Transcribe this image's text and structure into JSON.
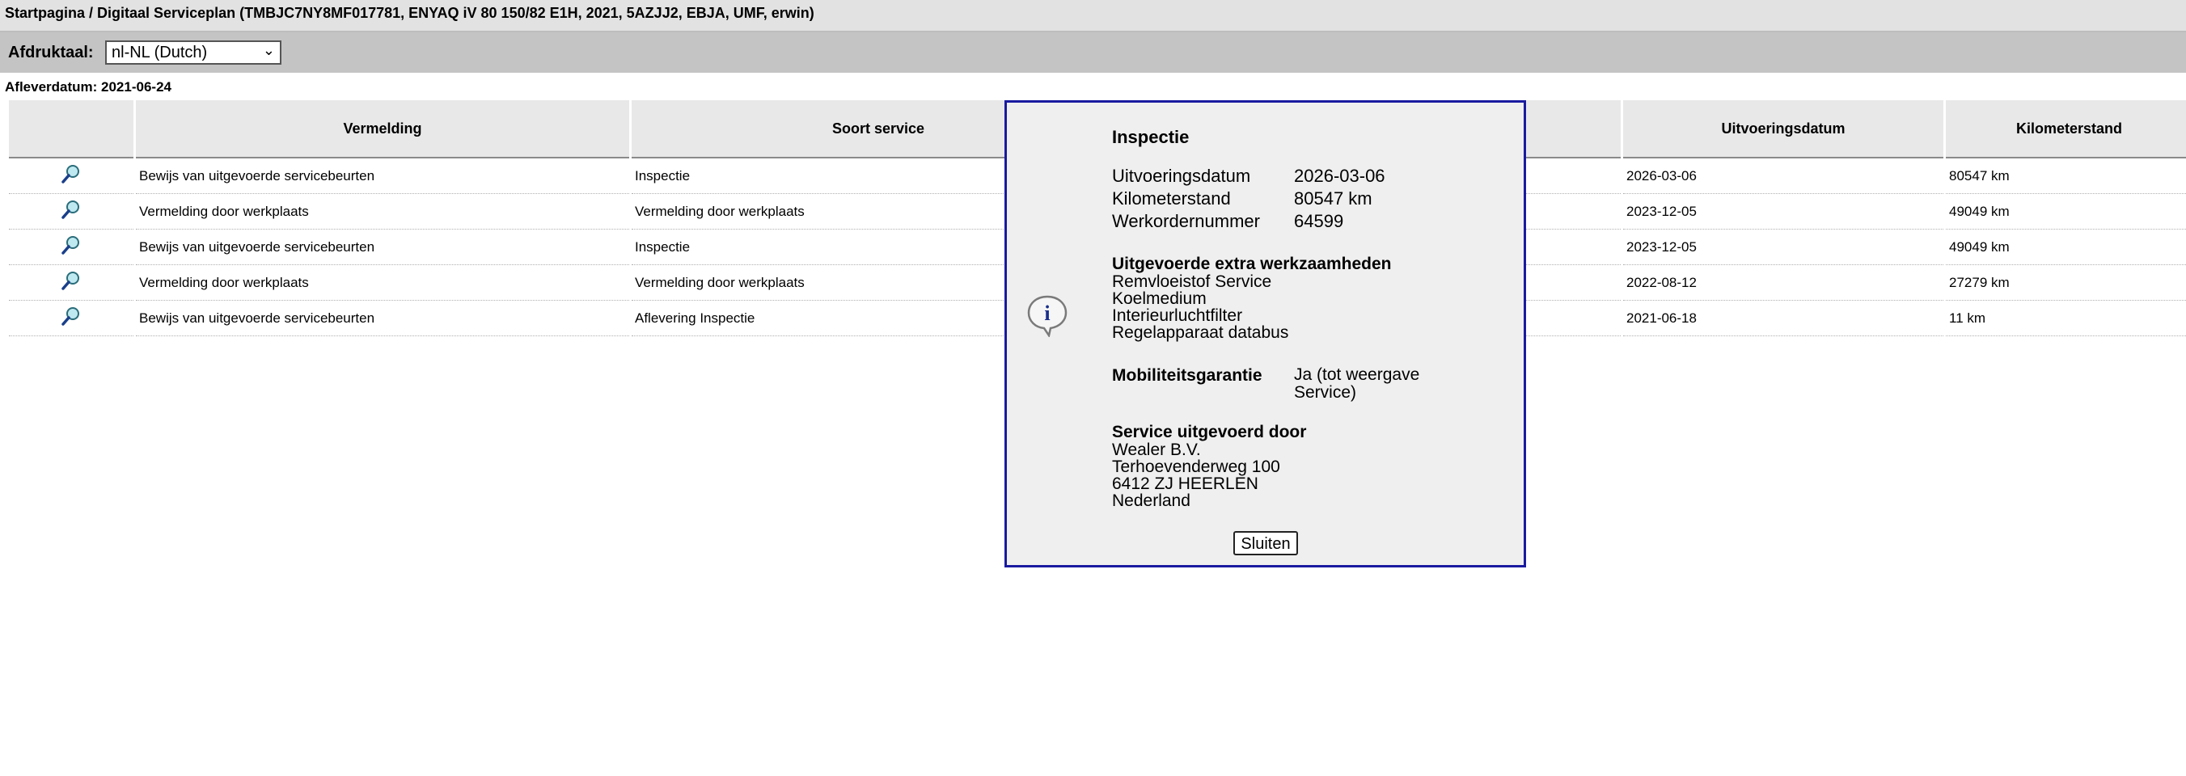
{
  "header": {
    "breadcrumb": "Startpagina / Digitaal Serviceplan (TMBJC7NY8MF017781, ENYAQ iV 80 150/82 E1H, 2021, 5AZJJ2, EBJA, UMF, erwin)"
  },
  "language": {
    "label": "Afdruktaal:",
    "selected": "nl-NL (Dutch)"
  },
  "delivery": {
    "text": "Afleverdatum: 2021-06-24"
  },
  "table": {
    "columns": [
      "",
      "Vermelding",
      "Soort service",
      "",
      "Uitvoeringsdatum",
      "Kilometerstand"
    ],
    "rows": [
      {
        "vermelding": "Bewijs van uitgevoerde servicebeurten",
        "soort": "Inspectie",
        "datum": "2026-03-06",
        "km": "80547 km"
      },
      {
        "vermelding": "Vermelding door werkplaats",
        "soort": "Vermelding door werkplaats",
        "datum": "2023-12-05",
        "km": "49049 km"
      },
      {
        "vermelding": "Bewijs van uitgevoerde servicebeurten",
        "soort": "Inspectie",
        "datum": "2023-12-05",
        "km": "49049 km"
      },
      {
        "vermelding": "Vermelding door werkplaats",
        "soort": "Vermelding door werkplaats",
        "datum": "2022-08-12",
        "km": "27279 km"
      },
      {
        "vermelding": "Bewijs van uitgevoerde servicebeurten",
        "soort": "Aflevering Inspectie",
        "datum": "2021-06-18",
        "km": "11 km"
      }
    ]
  },
  "dialog": {
    "title": "Inspectie",
    "fields": [
      {
        "label": "Uitvoeringsdatum",
        "value": "2026-03-06"
      },
      {
        "label": "Kilometerstand",
        "value": "80547 km"
      },
      {
        "label": "Werkordernummer",
        "value": "64599"
      }
    ],
    "extra_title": "Uitgevoerde extra werkzaamheden",
    "extra_items": [
      "Remvloeistof Service",
      "Koelmedium",
      "Interieurluchtfilter",
      "Regelapparaat databus"
    ],
    "mobility_label": "Mobiliteitsgarantie",
    "mobility_value": "Ja (tot weergave Service)",
    "service_title": "Service uitgevoerd door",
    "service_lines": [
      "Wealer B.V.",
      "Terhoevenderweg 100",
      "6412 ZJ HEERLEN",
      "Nederland"
    ],
    "close_label": "Sluiten"
  },
  "icons": {
    "row_detail": "magnifier-icon",
    "dialog": "info-bubble-icon"
  }
}
